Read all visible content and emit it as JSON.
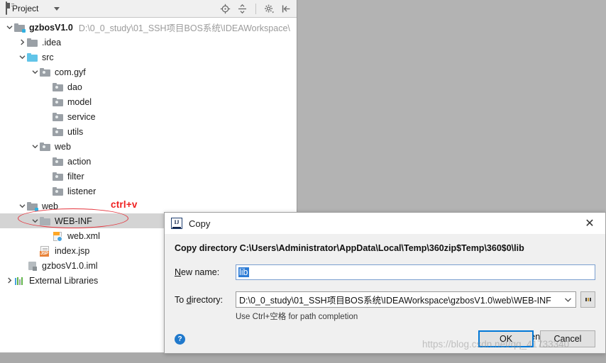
{
  "toolbar": {
    "title": "Project",
    "icons": [
      "project-view-icon",
      "dropdown-caret-icon",
      "locate-icon",
      "collapse-all-icon",
      "settings-gear-icon",
      "hide-icon"
    ]
  },
  "tree": {
    "items": [
      {
        "label": "gzbosV1.0",
        "path": "D:\\0_0_study\\01_SSH项目BOS系统\\IDEAWorkspace\\",
        "indent": 0,
        "arrow": "down",
        "icon": "module-folder",
        "bold": true
      },
      {
        "label": ".idea",
        "path": "",
        "indent": 1,
        "arrow": "right",
        "icon": "folder-gray",
        "bold": false
      },
      {
        "label": "src",
        "path": "",
        "indent": 1,
        "arrow": "down",
        "icon": "folder-cyan",
        "bold": false
      },
      {
        "label": "com.gyf",
        "path": "",
        "indent": 2,
        "arrow": "down",
        "icon": "package",
        "bold": false
      },
      {
        "label": "dao",
        "path": "",
        "indent": 3,
        "arrow": "none",
        "icon": "package",
        "bold": false
      },
      {
        "label": "model",
        "path": "",
        "indent": 3,
        "arrow": "none",
        "icon": "package",
        "bold": false
      },
      {
        "label": "service",
        "path": "",
        "indent": 3,
        "arrow": "none",
        "icon": "package",
        "bold": false
      },
      {
        "label": "utils",
        "path": "",
        "indent": 3,
        "arrow": "none",
        "icon": "package",
        "bold": false
      },
      {
        "label": "web",
        "path": "",
        "indent": 2,
        "arrow": "down",
        "icon": "package",
        "bold": false
      },
      {
        "label": "action",
        "path": "",
        "indent": 3,
        "arrow": "none",
        "icon": "package",
        "bold": false
      },
      {
        "label": "filter",
        "path": "",
        "indent": 3,
        "arrow": "none",
        "icon": "package",
        "bold": false
      },
      {
        "label": "listener",
        "path": "",
        "indent": 3,
        "arrow": "none",
        "icon": "package",
        "bold": false
      },
      {
        "label": "web",
        "path": "",
        "indent": 1,
        "arrow": "down",
        "icon": "folder-webroot",
        "bold": false
      },
      {
        "label": "WEB-INF",
        "path": "",
        "indent": 2,
        "arrow": "down",
        "icon": "folder-plain",
        "bold": false,
        "selected": true
      },
      {
        "label": "web.xml",
        "path": "",
        "indent": 3,
        "arrow": "none",
        "icon": "xml-file",
        "bold": false
      },
      {
        "label": "index.jsp",
        "path": "",
        "indent": 2,
        "arrow": "none",
        "icon": "jsp-file",
        "bold": false
      },
      {
        "label": "gzbosV1.0.iml",
        "path": "",
        "indent": 1,
        "arrow": "none",
        "icon": "iml-file",
        "bold": false
      },
      {
        "label": "External Libraries",
        "path": "",
        "indent": 0,
        "arrow": "right",
        "icon": "libraries",
        "bold": false
      }
    ]
  },
  "annotations": {
    "ctrl_v": "ctrl+v"
  },
  "dialog": {
    "title": "Copy",
    "close_label": "✕",
    "headline": "Copy directory C:\\Users\\Administrator\\AppData\\Local\\Temp\\360zip$Temp\\360$0\\lib",
    "new_name_label_prefix": "N",
    "new_name_label_rest": "ew name:",
    "new_name_value": "lib",
    "to_directory_label_prefix": "To ",
    "to_directory_label_mid": "d",
    "to_directory_label_rest": "irectory:",
    "to_directory_value": "D:\\0_0_study\\01_SSH项目BOS系统\\IDEAWorkspace\\gzbosV1.0\\web\\WEB-INF",
    "browse_label": "...",
    "hint": "Use Ctrl+空格 for path completion",
    "open_copy_prefix": "",
    "open_copy_underlined": "O",
    "open_copy_rest": "pen copy in editor",
    "checkbox_checked": true,
    "help_label": "?",
    "ok_label": "OK",
    "cancel_label": "Cancel",
    "accent_color": "#0078d7"
  },
  "watermark": {
    "text": "https://blog.csdn.net/qq_41733340"
  }
}
